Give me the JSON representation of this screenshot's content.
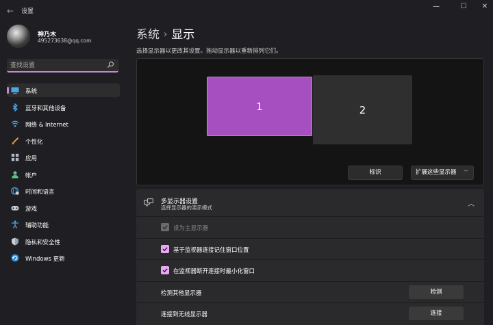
{
  "window": {
    "app_title": "设置",
    "back_glyph": "←",
    "minimize_glyph": "—",
    "maximize_glyph": "☐",
    "close_glyph": "✕"
  },
  "user": {
    "name": "神乃木",
    "email": "495273638@qq.com"
  },
  "search": {
    "placeholder": "查找设置",
    "value": ""
  },
  "sidebar": {
    "accent": "#c387d6",
    "items": [
      {
        "label": "系统",
        "icon": "system-icon",
        "active": true
      },
      {
        "label": "蓝牙和其他设备",
        "icon": "bluetooth-icon",
        "active": false
      },
      {
        "label": "网络 & Internet",
        "icon": "wifi-icon",
        "active": false
      },
      {
        "label": "个性化",
        "icon": "brush-icon",
        "active": false
      },
      {
        "label": "应用",
        "icon": "apps-icon",
        "active": false
      },
      {
        "label": "帐户",
        "icon": "account-icon",
        "active": false
      },
      {
        "label": "时间和语言",
        "icon": "globe-clock-icon",
        "active": false
      },
      {
        "label": "游戏",
        "icon": "gamepad-icon",
        "active": false
      },
      {
        "label": "辅助功能",
        "icon": "accessibility-icon",
        "active": false
      },
      {
        "label": "隐私和安全性",
        "icon": "shield-icon",
        "active": false
      },
      {
        "label": "Windows 更新",
        "icon": "update-icon",
        "active": false
      }
    ]
  },
  "main": {
    "breadcrumb": {
      "parent": "系统",
      "separator": "›",
      "current": "显示"
    },
    "hint": "选择显示器以更改其设置。拖动显示器以重新排列它们。",
    "monitors": [
      {
        "label": "1",
        "selected": true
      },
      {
        "label": "2",
        "selected": false
      }
    ],
    "identify_label": "标识",
    "extend_label": "扩展这些显示器"
  },
  "multi_display": {
    "title": "多显示器设置",
    "subtitle": "选择显示器的演示模式",
    "rows": [
      {
        "label": "设为主显示器",
        "checked": true,
        "disabled": true
      },
      {
        "label": "基于监视器连接记住窗口位置",
        "checked": true,
        "disabled": false
      },
      {
        "label": "在监视器断开连接时最小化窗口",
        "checked": true,
        "disabled": false
      }
    ],
    "detect": {
      "label": "检测其他显示器",
      "button": "检测"
    },
    "wireless": {
      "label": "连接到无线显示器",
      "button": "连接"
    }
  }
}
